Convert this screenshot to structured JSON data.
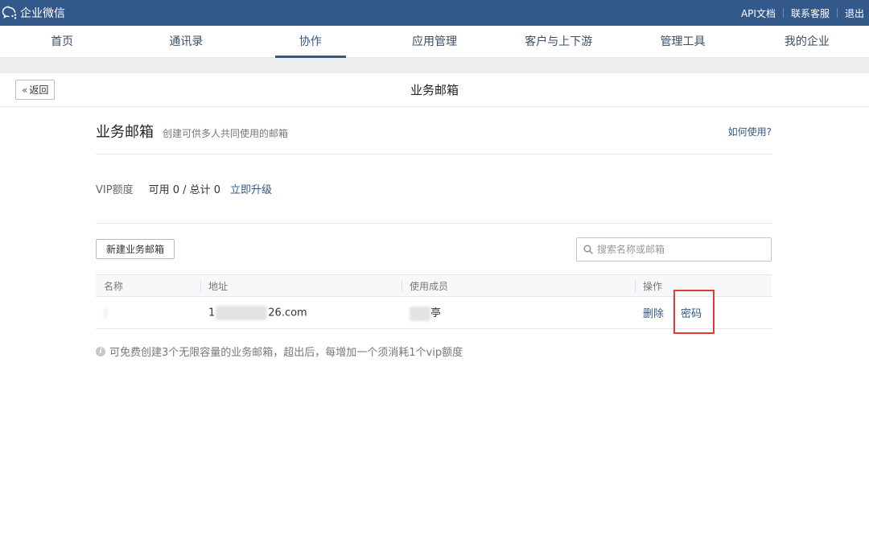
{
  "topbar": {
    "brand": "企业微信",
    "links": [
      "API文档",
      "联系客服",
      "退出"
    ],
    "bg_color": "#33588a"
  },
  "nav": {
    "tabs": [
      "首页",
      "通讯录",
      "协作",
      "应用管理",
      "客户与上下游",
      "管理工具",
      "我的企业"
    ],
    "active": "协作"
  },
  "page": {
    "back_label": "返回",
    "title": "业务邮箱"
  },
  "section": {
    "title": "业务邮箱",
    "desc": "创建可供多人共同使用的邮箱",
    "help": "如何使用?"
  },
  "vip": {
    "label": "VIP额度",
    "count": "可用 0 / 总计 0",
    "upgrade": "立即升级"
  },
  "toolbar": {
    "new_button": "新建业务邮箱",
    "search_placeholder": "搜索名称或邮箱"
  },
  "table": {
    "headers": [
      "名称",
      "地址",
      "使用成员",
      "操作"
    ],
    "rows": [
      {
        "address_prefix": "1",
        "address_suffix": "26.com",
        "member_suffix": "亭",
        "actions": [
          "删除",
          "密码"
        ]
      }
    ]
  },
  "note": "可免费创建3个无限容量的业务邮箱，超出后，每增加一个须消耗1个vip额度",
  "icons": {
    "brand": "chat-bubbles-icon",
    "search": "search-icon",
    "back": "double-chevron-left-icon",
    "info": "info-icon"
  },
  "colors": {
    "accent": "#33588a",
    "highlight": "#e53935"
  }
}
